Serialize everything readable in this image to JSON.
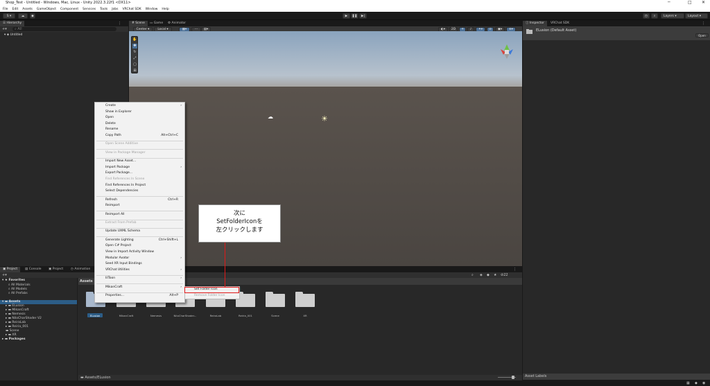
{
  "window": {
    "title": "Shop_Test - Untitled - Windows, Mac, Linux - Unity 2022.3.22f1 <DX11>",
    "minimize": "─",
    "maximize": "□",
    "close": "✕"
  },
  "menubar": [
    "File",
    "Edit",
    "Assets",
    "GameObject",
    "Component",
    "Services",
    "Tools",
    "Jobs",
    "VRChat SDK",
    "Window",
    "Help"
  ],
  "toolbar": {
    "account": "S",
    "layers": "Layers",
    "layout": "Layout"
  },
  "hierarchy": {
    "tab": "Hierarchy",
    "search_placeholder": "All",
    "root": "Untitled"
  },
  "scene": {
    "tabs": [
      "Scene",
      "Game",
      "Animator"
    ],
    "pivot": "Center",
    "space": "Local",
    "view2d": "2D"
  },
  "context_menu": {
    "items": [
      {
        "label": "Create",
        "arrow": true
      },
      {
        "label": "Show in Explorer"
      },
      {
        "label": "Open"
      },
      {
        "label": "Delete"
      },
      {
        "label": "Rename"
      },
      {
        "label": "Copy Path",
        "shortcut": "Alt+Ctrl+C"
      },
      {
        "sep": true
      },
      {
        "label": "Open Scene Additive",
        "disabled": true
      },
      {
        "sep": true
      },
      {
        "label": "View in Package Manager",
        "disabled": true
      },
      {
        "sep": true
      },
      {
        "label": "Import New Asset..."
      },
      {
        "label": "Import Package",
        "arrow": true
      },
      {
        "label": "Export Package..."
      },
      {
        "label": "Find References In Scene",
        "disabled": true
      },
      {
        "label": "Find References In Project"
      },
      {
        "label": "Select Dependencies"
      },
      {
        "sep": true
      },
      {
        "label": "Refresh",
        "shortcut": "Ctrl+R"
      },
      {
        "label": "Reimport"
      },
      {
        "sep": true
      },
      {
        "label": "Reimport All"
      },
      {
        "sep": true
      },
      {
        "label": "Extract From Prefab",
        "disabled": true
      },
      {
        "sep": true
      },
      {
        "label": "Update UXML Schema"
      },
      {
        "sep": true
      },
      {
        "label": "Generate Lighting",
        "shortcut": "Ctrl+Shift+L"
      },
      {
        "label": "Open C# Project"
      },
      {
        "label": "View in Import Activity Window"
      },
      {
        "label": "Modular Avatar",
        "arrow": true
      },
      {
        "label": "Seed XR Input Bindings"
      },
      {
        "label": "VRChat Utilities",
        "arrow": true
      },
      {
        "sep": true
      },
      {
        "label": "lilToon",
        "arrow": true
      },
      {
        "sep": true
      },
      {
        "label": "MikanCraft",
        "arrow": true
      },
      {
        "sep": true
      },
      {
        "label": "Properties...",
        "shortcut": "Alt+P"
      }
    ],
    "submenu": [
      {
        "label": "Set Folder Icon"
      },
      {
        "label": "Remove Folder Icon",
        "disabled": true
      }
    ]
  },
  "callout": {
    "lines": [
      "次に",
      "SetFolderIconを",
      "左クリックします"
    ]
  },
  "inspector": {
    "tabs": [
      "Inspector",
      "VRChat SDK"
    ],
    "asset_title": "ELusion (Default Asset)",
    "open_button": "Open",
    "asset_labels": "Asset Labels"
  },
  "project": {
    "tabs": [
      "Project",
      "Console",
      "Project",
      "Animation"
    ],
    "favorites": {
      "label": "Favorites",
      "items": [
        "All Materials",
        "All Models",
        "All Prefabs"
      ]
    },
    "assets": {
      "label": "Assets",
      "items": [
        "ELusion",
        "MikanCraft",
        "Nemesis",
        "NiloCharShader V2",
        "ReiraLab",
        "Reiria_001",
        "Scene",
        "XR"
      ]
    },
    "packages": "Packages",
    "breadcrumb": "Assets",
    "folders": [
      "ELusion",
      "MikanCraft",
      "Nemesis",
      "NiloCharShader...",
      "ReiraLab",
      "Reiria_001",
      "Scene",
      "XR"
    ],
    "path": "Assets/ELusion",
    "count": "22"
  },
  "colors": {
    "selection": "#2c5d87",
    "highlight_red": "#e01818"
  }
}
